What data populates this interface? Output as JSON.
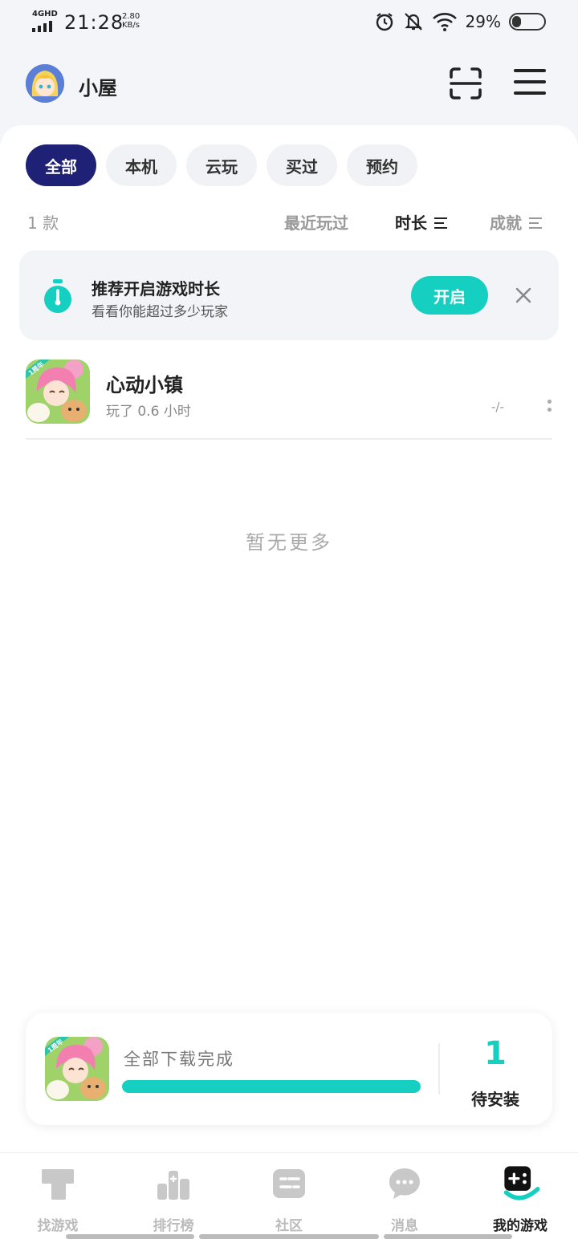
{
  "status_bar": {
    "network": "4GHD",
    "time": "21:28",
    "speed_value": "2.80",
    "speed_unit": "KB/s",
    "battery": "29%",
    "battery_level": 0.29
  },
  "header": {
    "title": "小屋"
  },
  "filters": {
    "chips": [
      "全部",
      "本机",
      "云玩",
      "买过",
      "预约"
    ],
    "active_index": 0
  },
  "sort": {
    "count": "1 款",
    "options": [
      "最近玩过",
      "时长",
      "成就"
    ],
    "active_index": 1
  },
  "banner": {
    "title": "推荐开启游戏时长",
    "subtitle": "看看你能超过多少玩家",
    "button": "开启"
  },
  "games": [
    {
      "name": "心动小镇",
      "played": "玩了 0.6 小时",
      "achievement": "-/-",
      "badge": "1周年"
    }
  ],
  "empty_text": "暂无更多",
  "download": {
    "label": "全部下载完成",
    "progress": 1.0,
    "pending_count": "1",
    "pending_label": "待安装",
    "badge": "1周年"
  },
  "tabbar": {
    "items": [
      "找游戏",
      "排行榜",
      "社区",
      "消息",
      "我的游戏"
    ],
    "active_index": 4
  },
  "colors": {
    "accent": "#15cfc0",
    "chip_active": "#1f2176"
  }
}
